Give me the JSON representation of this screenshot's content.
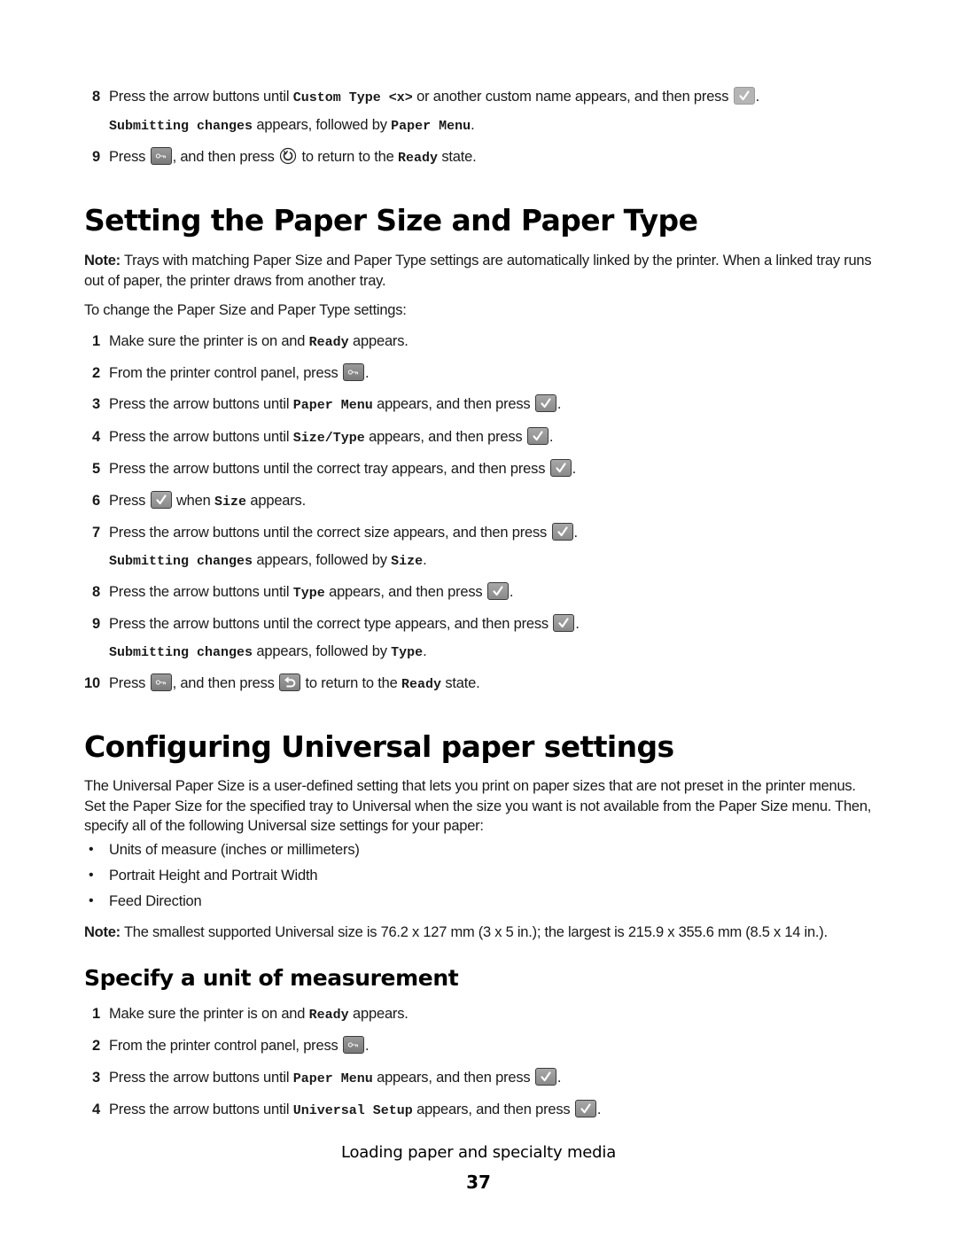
{
  "top_steps": [
    {
      "num": "8",
      "pre": "Press the arrow buttons until ",
      "code": "Custom Type <x>",
      "post": " or another custom name appears, and then press ",
      "icon": "select-check-icon",
      "end": "."
    },
    {
      "sub_code1": "Submitting changes",
      "sub_mid": " appears, followed by ",
      "sub_code2": "Paper Menu",
      "sub_end": "."
    },
    {
      "num": "9",
      "pre": "Press ",
      "icon1": "menu-key-icon",
      "mid": ", and then press ",
      "icon2": "return-circle-icon",
      "post": " to return to the ",
      "code": "Ready",
      "end": " state."
    }
  ],
  "section1": {
    "title": "Setting the Paper Size and Paper Type",
    "note_label": "Note:",
    "note_text": " Trays with matching Paper Size and Paper Type settings are automatically linked by the printer. When a linked tray runs out of paper, the printer draws from another tray.",
    "intro": "To change the Paper Size and Paper Type settings:",
    "steps": [
      {
        "num": "1",
        "pre": "Make sure the printer is on and ",
        "code": "Ready",
        "post": " appears."
      },
      {
        "num": "2",
        "pre": "From the printer control panel, press ",
        "icon": "menu-key-icon",
        "post": "."
      },
      {
        "num": "3",
        "pre": "Press the arrow buttons until ",
        "code": "Paper Menu",
        "post": " appears, and then press ",
        "icon": "select-check-icon",
        "end": "."
      },
      {
        "num": "4",
        "pre": "Press the arrow buttons until ",
        "code": "Size/Type",
        "post": " appears, and then press ",
        "icon": "select-check-icon",
        "end": "."
      },
      {
        "num": "5",
        "pre": "Press the arrow buttons until the correct tray appears, and then press ",
        "icon": "select-check-icon",
        "post": "."
      },
      {
        "num": "6",
        "pre": "Press ",
        "icon": "select-check-icon",
        "mid": " when ",
        "code": "Size",
        "post": " appears."
      },
      {
        "num": "7",
        "pre": "Press the arrow buttons until the correct size appears, and then press ",
        "icon": "select-check-icon",
        "post": ".",
        "sub_code1": "Submitting changes",
        "sub_mid": " appears, followed by ",
        "sub_code2": "Size",
        "sub_end": "."
      },
      {
        "num": "8",
        "pre": "Press the arrow buttons until ",
        "code": "Type",
        "post": " appears, and then press ",
        "icon": "select-check-icon",
        "end": "."
      },
      {
        "num": "9",
        "pre": "Press the arrow buttons until the correct type appears, and then press ",
        "icon": "select-check-icon",
        "post": ".",
        "sub_code1": "Submitting changes",
        "sub_mid": " appears, followed by ",
        "sub_code2": "Type",
        "sub_end": "."
      },
      {
        "num": "10",
        "pre": "Press ",
        "icon1": "menu-key-icon",
        "mid": ", and then press ",
        "icon2": "back-arrow-icon",
        "post": " to return to the ",
        "code": "Ready",
        "end": " state."
      }
    ]
  },
  "section2": {
    "title": "Configuring Universal paper settings",
    "intro": "The Universal Paper Size is a user-defined setting that lets you print on paper sizes that are not preset in the printer menus. Set the Paper Size for the specified tray to Universal when the size you want is not available from the Paper Size menu. Then, specify all of the following Universal size settings for your paper:",
    "bullets": [
      "Units of measure (inches or millimeters)",
      "Portrait Height and Portrait Width",
      "Feed Direction"
    ],
    "note_label": "Note:",
    "note_text": " The smallest supported Universal size is 76.2 x 127 mm (3  x 5 in.); the largest is 215.9 x 355.6 mm (8.5 x 14 in.)."
  },
  "section3": {
    "title": "Specify a unit of measurement",
    "steps": [
      {
        "num": "1",
        "pre": "Make sure the printer is on and ",
        "code": "Ready",
        "post": " appears."
      },
      {
        "num": "2",
        "pre": "From the printer control panel, press ",
        "icon": "menu-key-icon",
        "post": "."
      },
      {
        "num": "3",
        "pre": "Press the arrow buttons until ",
        "code": "Paper Menu",
        "post": " appears, and then press ",
        "icon": "select-check-icon",
        "end": "."
      },
      {
        "num": "4",
        "pre": "Press the arrow buttons until ",
        "code": "Universal Setup",
        "post": " appears, and then press ",
        "icon": "select-check-icon",
        "end": "."
      }
    ]
  },
  "footer": {
    "chapter": "Loading paper and specialty media",
    "page_number": "37"
  }
}
